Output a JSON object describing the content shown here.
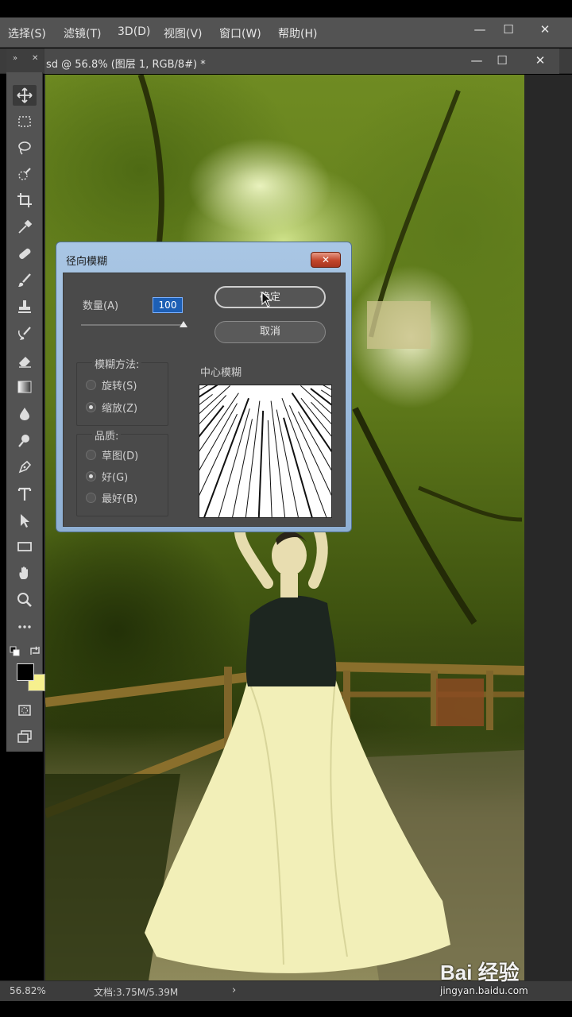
{
  "menu": {
    "items": [
      "选择(S)",
      "滤镜(T)",
      "3D(D)",
      "视图(V)",
      "窗口(W)",
      "帮助(H)"
    ],
    "minimize": "—",
    "restore": "☐",
    "close": "✕"
  },
  "document": {
    "title": "sd @ 56.8% (图层 1, RGB/8#) *",
    "minimize": "—",
    "restore": "☐",
    "close": "✕"
  },
  "toolbar": {
    "collapse": "»",
    "close": "✕"
  },
  "dialog": {
    "title": "径向模糊",
    "close_label": "✕",
    "amount_label": "数量(A)",
    "amount_value": "100",
    "ok_label": "确定",
    "cancel_label": "取消",
    "blur_method_label": "模糊方法:",
    "method_spin": "旋转(S)",
    "method_zoom": "缩放(Z)",
    "selected_method": "zoom",
    "quality_label": "品质:",
    "quality_draft": "草图(D)",
    "quality_good": "好(G)",
    "quality_best": "最好(B)",
    "selected_quality": "good",
    "center_label": "中心模糊"
  },
  "status": {
    "zoom": "56.82%",
    "doc_size": "文档:3.75M/5.39M",
    "arrow": "›"
  },
  "watermark": {
    "text": "Bai 经验",
    "url": "jingyan.baidu.com"
  },
  "colors": {
    "foreground": "#000000",
    "background": "#f6f08e"
  }
}
